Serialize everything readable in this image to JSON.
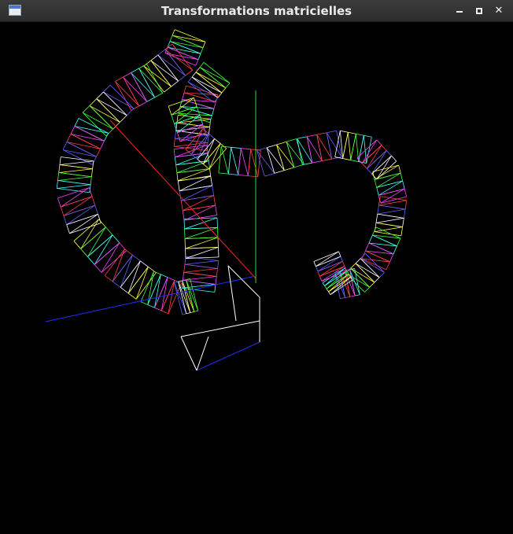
{
  "window": {
    "title": "Transformations matricielles",
    "buttons": {
      "close_glyph": "✕"
    }
  },
  "icons": [
    "app-window-icon",
    "minimize-icon",
    "maximize-icon",
    "close-icon"
  ],
  "colors": {
    "background": "#000000",
    "axis_x": "#ff2020",
    "axis_y": "#30e030",
    "axis_z": "#2030ff",
    "mesh_palette": [
      "#ffff40",
      "#40ff40",
      "#40ffff",
      "#ff40ff",
      "#ff4040",
      "#6060ff",
      "#ffffff"
    ]
  }
}
